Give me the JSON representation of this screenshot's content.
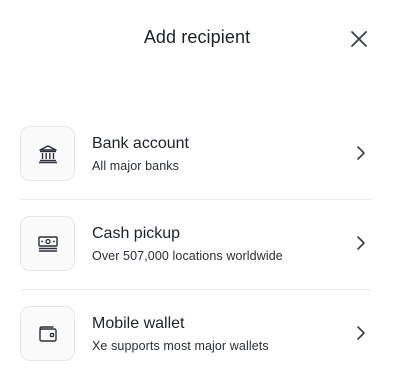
{
  "dialog": {
    "title": "Add recipient",
    "close_icon": "close-icon"
  },
  "options": [
    {
      "title": "Bank account",
      "subtitle": "All major banks",
      "icon": "bank-icon"
    },
    {
      "title": "Cash pickup",
      "subtitle": "Over 507,000 locations worldwide",
      "icon": "cash-icon"
    },
    {
      "title": "Mobile wallet",
      "subtitle": "Xe supports most major wallets",
      "icon": "wallet-icon"
    }
  ],
  "colors": {
    "text": "#1d2129",
    "divider": "#e9ebee",
    "tile_border": "#e5e7eb"
  }
}
